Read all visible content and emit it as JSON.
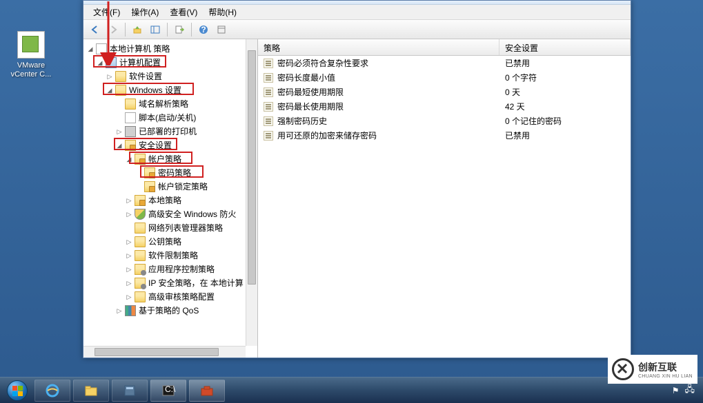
{
  "desktop": {
    "icon_label": "VMware vCenter C..."
  },
  "menu": {
    "file": "文件(F)",
    "action": "操作(A)",
    "view": "查看(V)",
    "help": "帮助(H)"
  },
  "tree": {
    "root": "本地计算机 策略",
    "computer_config": "计算机配置",
    "software_settings": "软件设置",
    "windows_settings": "Windows 设置",
    "dns_policy": "域名解析策略",
    "scripts": "脚本(启动/关机)",
    "deployed_printers": "已部署的打印机",
    "security_settings": "安全设置",
    "account_policy": "帐户策略",
    "password_policy": "密码策略",
    "lockout_policy": "帐户锁定策略",
    "local_policy": "本地策略",
    "advanced_firewall": "高级安全 Windows 防火",
    "network_list": "网络列表管理器策略",
    "pubkey_policy": "公钥策略",
    "software_restrict": "软件限制策略",
    "app_control": "应用程序控制策略",
    "ip_security": "IP 安全策略，在 本地计算",
    "audit_policy": "高级审核策略配置",
    "qos_policy": "基于策略的 QoS"
  },
  "list": {
    "header_policy": "策略",
    "header_setting": "安全设置",
    "rows": [
      {
        "policy": "密码必须符合复杂性要求",
        "setting": "已禁用"
      },
      {
        "policy": "密码长度最小值",
        "setting": "0 个字符"
      },
      {
        "policy": "密码最短使用期限",
        "setting": "0 天"
      },
      {
        "policy": "密码最长使用期限",
        "setting": "42 天"
      },
      {
        "policy": "强制密码历史",
        "setting": "0 个记住的密码"
      },
      {
        "policy": "用可还原的加密来储存密码",
        "setting": "已禁用"
      }
    ]
  },
  "logo": {
    "cn": "创新互联",
    "en": "CHUANG XIN HU LIAN"
  }
}
